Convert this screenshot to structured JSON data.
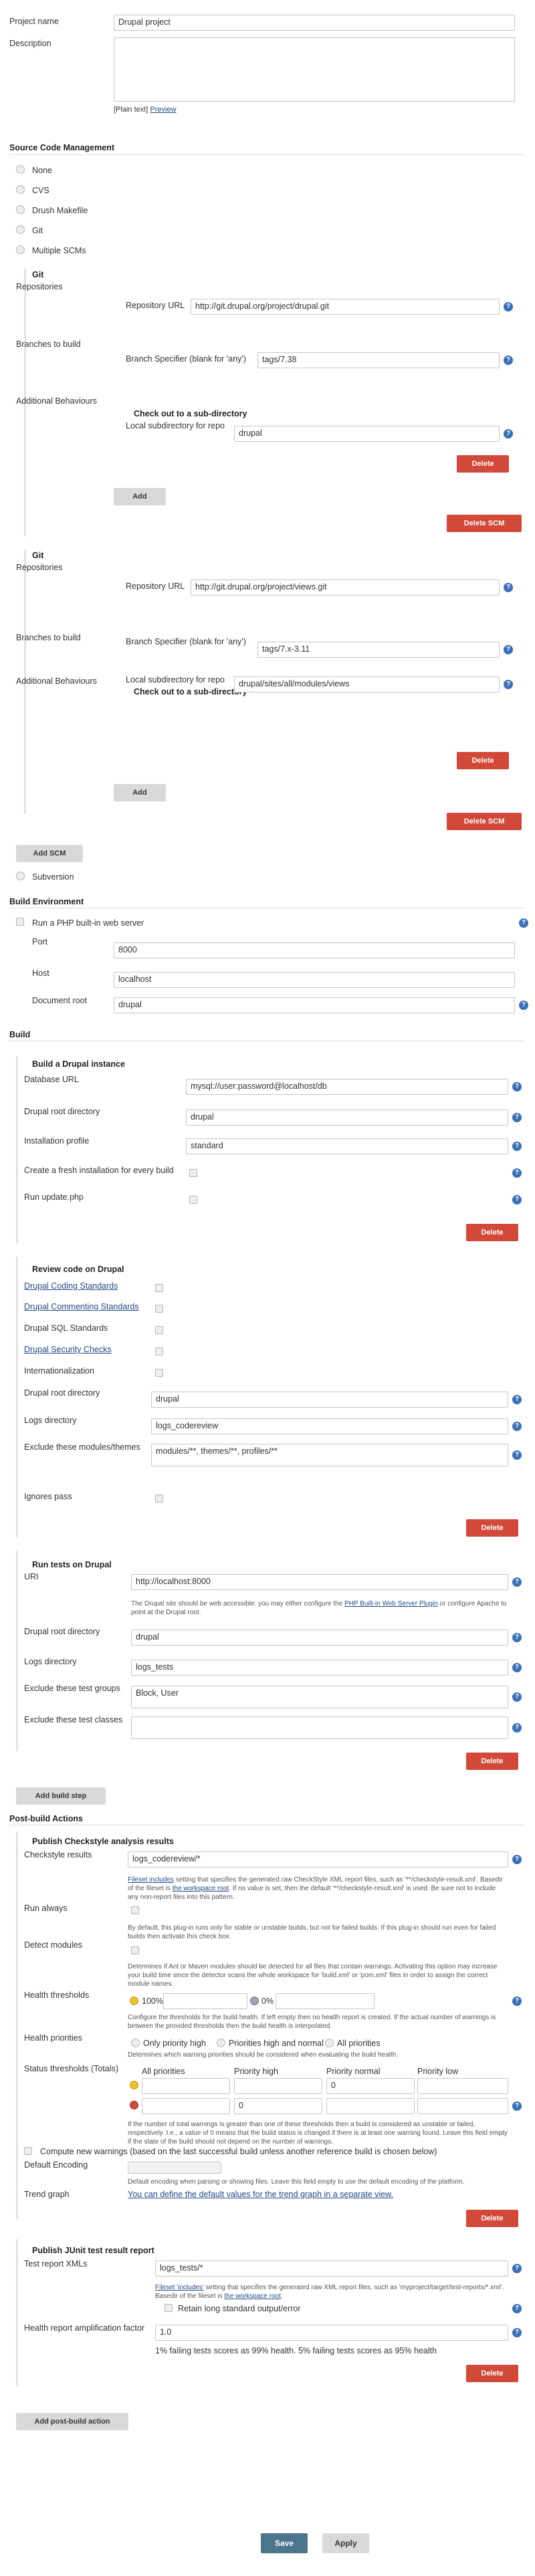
{
  "project": {
    "name_label": "Project name",
    "name_value": "Drupal project",
    "description_label": "Description",
    "plain_text": "[Plain text]",
    "preview": "Preview"
  },
  "scm": {
    "title": "Source Code Management",
    "options": [
      "None",
      "CVS",
      "Drush Makefile",
      "Git",
      "Multiple SCMs"
    ],
    "git_title": "Git",
    "repositories_label": "Repositories",
    "repo_url_label": "Repository URL",
    "branches_label": "Branches to build",
    "branch_spec_label": "Branch Specifier (blank for 'any')",
    "additional_label": "Additional Behaviours",
    "checkout_title": "Check out to a sub-directory",
    "local_subdir_label": "Local subdirectory for repo",
    "delete": "Delete",
    "delete_scm": "Delete SCM",
    "add": "Add",
    "repos": [
      {
        "url": "http://git.drupal.org/project/drupal.git",
        "branch": "tags/7.38",
        "subdir": "drupal"
      },
      {
        "url": "http://git.drupal.org/project/views.git",
        "branch": "tags/7.x-3.11",
        "subdir": "drupal/sites/all/modules/views"
      }
    ],
    "add_scm": "Add SCM",
    "subversion": "Subversion"
  },
  "build_env": {
    "title": "Build Environment",
    "php_server": "Run a PHP built-in web server",
    "port_label": "Port",
    "port_value": "8000",
    "host_label": "Host",
    "host_value": "localhost",
    "docroot_label": "Document root",
    "docroot_value": "drupal"
  },
  "build": {
    "title": "Build",
    "drupal_title": "Build a Drupal instance",
    "db_url_label": "Database URL",
    "db_url_value": "mysql://user:password@localhost/db",
    "root_label": "Drupal root directory",
    "root_value": "drupal",
    "profile_label": "Installation profile",
    "profile_value": "standard",
    "fresh_label": "Create a fresh installation for every build",
    "update_label": "Run update.php",
    "delete": "Delete",
    "review_title": "Review code on Drupal",
    "coding_standards": "Drupal Coding Standards",
    "commenting_standards": "Drupal Commenting Standards",
    "sql_standards": "Drupal SQL Standards",
    "security_checks": "Drupal Security Checks",
    "i18n": "Internationalization",
    "review_root_label": "Drupal root directory",
    "review_root_value": "drupal",
    "logs_label": "Logs directory",
    "logs_value": "logs_codereview",
    "exclude_label": "Exclude these modules/themes",
    "exclude_value": "modules/**, themes/**, profiles/**",
    "ignores_pass": "Ignores pass",
    "tests_title": "Run tests on Drupal",
    "uri_label": "URI",
    "uri_value": "http://localhost:8000",
    "uri_note_a": "The Drupal site should be web accessible: you may either configure the ",
    "uri_note_link": "PHP Built-in Web Server Plugin",
    "uri_note_b": " or configure Apache to point at the Drupal root.",
    "tests_root_label": "Drupal root directory",
    "tests_root_value": "drupal",
    "tests_logs_label": "Logs directory",
    "tests_logs_value": "logs_tests",
    "exclude_groups_label": "Exclude these test groups",
    "exclude_groups_value": "Block, User",
    "exclude_classes_label": "Exclude these test classes",
    "exclude_classes_value": "",
    "add_build_step": "Add build step"
  },
  "post": {
    "title": "Post-build Actions",
    "checkstyle_title": "Publish Checkstyle analysis results",
    "checkstyle_label": "Checkstyle results",
    "checkstyle_value": "logs_codereview/*",
    "checkstyle_note_link1": "Fileset includes",
    "checkstyle_note_a": " setting that specifies the generated raw CheckStyle XML report files, such as '**/checkstyle-result.xml'. Basedir of the fileset is ",
    "checkstyle_note_link2": "the workspace root",
    "checkstyle_note_b": ". If no value is set, then the default '**/checkstyle-result.xml' is used. Be sure not to include any non-report files into this pattern.",
    "run_always": "Run always",
    "run_always_note": "By default, this plug-in runs only for stable or unstable builds, but not for failed builds. If this plug-in should run even for failed builds then activate this check box.",
    "detect_modules": "Detect modules",
    "detect_note": "Determines if Ant or Maven modules should be detected for all files that contain warnings. Activating this option may increase your build time since the detector scans the whole workspace for 'build.xml' or 'pom.xml' files in order to assign the correct module names.",
    "health_label": "Health thresholds",
    "health_a": "100%",
    "health_b": "0%",
    "health_note": "Configure the thresholds for the build health. If left empty then no health report is created. If the actual number of warnings is between the provided thresholds then the build health is interpolated.",
    "priorities_label": "Health priorities",
    "prio_only_high": "Only priority high",
    "prio_high_normal": "Priorities high and normal",
    "prio_all": "All priorities",
    "prio_note": "Determines which warning priorities should be considered when evaluating the build health.",
    "status_label": "Status thresholds (Totals)",
    "status_cols": [
      "All priorities",
      "Priority high",
      "Priority normal",
      "Priority low"
    ],
    "status_row1": [
      "",
      "",
      "0",
      ""
    ],
    "status_row2": [
      "",
      "0",
      "",
      ""
    ],
    "status_note": "If the number of total warnings is greater than one of these thresholds then a build is considered as unstable or failed, respectively. I.e., a value of 0 means that the build status is changed if there is at least one warning found. Leave this field empty if the state of the build should not depend on the number of warnings.",
    "compute_new": "Compute new warnings (based on the last successful build unless another reference build is chosen below)",
    "encoding_label": "Default Encoding",
    "encoding_note": "Default encoding when parsing or showing files. Leave this field empty to use the default encoding of the platform.",
    "trend_label": "Trend graph",
    "trend_link": "You can define the default values for the trend graph in a separate view.",
    "delete": "Delete",
    "junit_title": "Publish JUnit test result report",
    "junit_label": "Test report XMLs",
    "junit_value": "logs_tests/*",
    "junit_note_link1": "Fileset 'includes'",
    "junit_note_a": " setting that specifies the generated raw XML report files, such as 'myproject/target/test-reports/*.xml'. Basedir of the fileset is ",
    "junit_note_link2": "the workspace root",
    "junit_note_b": ".",
    "retain": "Retain long standard output/error",
    "amp_label": "Health report amplification factor",
    "amp_value": "1.0",
    "amp_note": "1% failing tests scores as 99% health. 5% failing tests scores as 95% health",
    "add_post": "Add post-build action"
  },
  "footer": {
    "save": "Save",
    "apply": "Apply"
  },
  "icons": {
    "help": "help-icon",
    "warning": "warning-icon",
    "error": "error-icon"
  },
  "colors": {
    "delete": "#d24939",
    "help": "#3b6fb6",
    "save": "#4b758b",
    "link": "#204a87"
  }
}
